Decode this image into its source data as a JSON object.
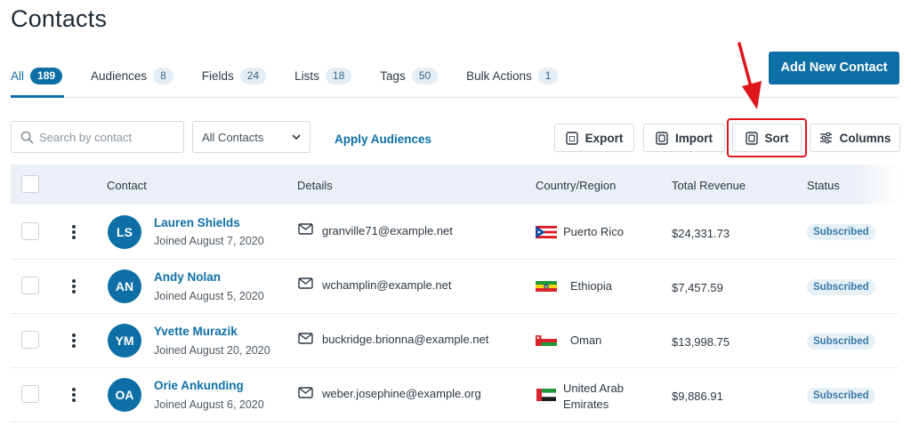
{
  "page": {
    "title": "Contacts"
  },
  "tabs": [
    {
      "label": "All",
      "count": "189",
      "active": true
    },
    {
      "label": "Audiences",
      "count": "8"
    },
    {
      "label": "Fields",
      "count": "24"
    },
    {
      "label": "Lists",
      "count": "18"
    },
    {
      "label": "Tags",
      "count": "50"
    },
    {
      "label": "Bulk Actions",
      "count": "1"
    }
  ],
  "header": {
    "add_button": "Add New Contact"
  },
  "filters": {
    "search_placeholder": "Search by contact",
    "select_value": "All Contacts",
    "apply_link": "Apply Audiences"
  },
  "toolbar": {
    "export": "Export",
    "import": "Import",
    "sort": "Sort",
    "columns": "Columns"
  },
  "table": {
    "columns": [
      "Contact",
      "Details",
      "Country/Region",
      "Total Revenue",
      "Status"
    ],
    "rows": [
      {
        "initials": "LS",
        "name": "Lauren Shields",
        "joined": "Joined August 7, 2020",
        "email": "granville71@example.net",
        "country": "Puerto Rico",
        "revenue": "$24,331.73",
        "status": "Subscribed"
      },
      {
        "initials": "AN",
        "name": "Andy Nolan",
        "joined": "Joined August 5, 2020",
        "email": "wchamplin@example.net",
        "country": "Ethiopia",
        "revenue": "$7,457.59",
        "status": "Subscribed"
      },
      {
        "initials": "YM",
        "name": "Yvette Murazik",
        "joined": "Joined August 20, 2020",
        "email": "buckridge.brionna@example.net",
        "country": "Oman",
        "revenue": "$13,998.75",
        "status": "Subscribed"
      },
      {
        "initials": "OA",
        "name": "Orie Ankunding",
        "joined": "Joined August 6, 2020",
        "email": "weber.josephine@example.org",
        "country_line1": "United Arab",
        "country_line2": "Emirates",
        "revenue": "$9,886.91",
        "status": "Subscribed"
      }
    ]
  },
  "colors": {
    "accent": "#0e6fa7",
    "highlight": "#e0161d",
    "header_bg": "#eaf0f5",
    "badge_bg": "#e3eef7"
  },
  "icons": {
    "search": "search-icon",
    "chevron": "chevron-down-icon",
    "export": "export-icon",
    "import": "import-icon",
    "sort": "sort-icon",
    "columns": "sliders-icon",
    "mail": "mail-icon",
    "kebab": "more-vertical-icon",
    "arrow": "annotation-arrow-icon"
  }
}
